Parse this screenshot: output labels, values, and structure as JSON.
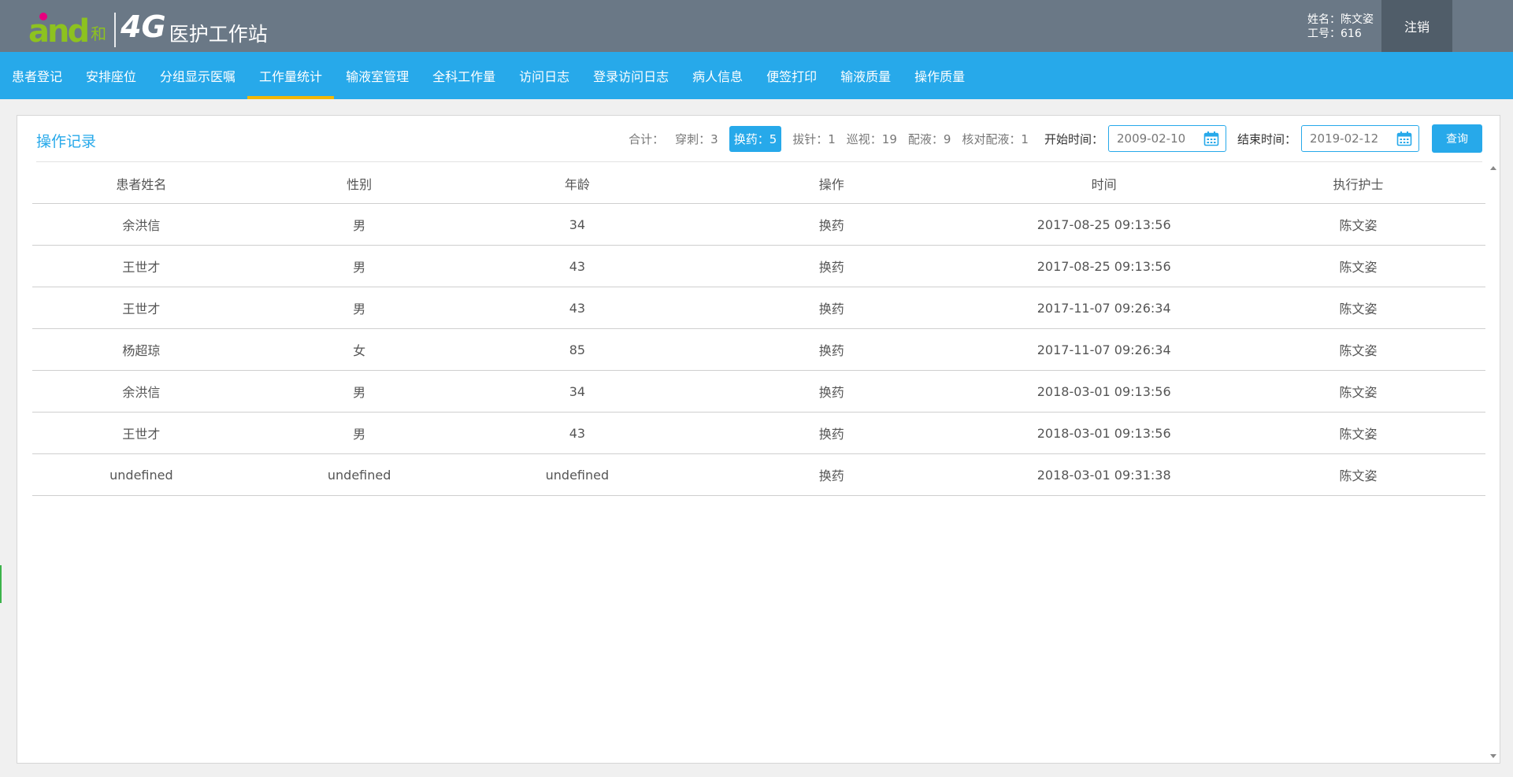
{
  "header": {
    "logo_and": "and",
    "logo_he": "和",
    "logo_4g": "4G",
    "app_title": "医护工作站",
    "user_name": "姓名：陈文姿",
    "user_id": "工号：616",
    "logout_label": "注销",
    "colors": {
      "bar": "#6a7886",
      "logo_green": "#8dc21f",
      "logo_pink": "#e6007e"
    }
  },
  "nav": {
    "items": [
      "患者登记",
      "安排座位",
      "分组显示医嘱",
      "工作量统计",
      "输液室管理",
      "全科工作量",
      "访问日志",
      "登录访问日志",
      "病人信息",
      "便签打印",
      "输液质量",
      "操作质量"
    ],
    "active_index": 3,
    "colors": {
      "bg": "#27a9ea",
      "active_underline": "#f2b705"
    }
  },
  "panel": {
    "title": "操作记录",
    "stats_label": "合计：",
    "stats": [
      "穿刺：3",
      "换药：5",
      "拔针：1",
      "巡视：19",
      "配液：9",
      "核对配液：1"
    ],
    "active_stat_index": 1,
    "start_label": "开始时间：",
    "start_value": "2009-02-10",
    "end_label": "结束时间：",
    "end_value": "2019-02-12",
    "calendar_icon": "calendar-icon",
    "query_label": "查询"
  },
  "table": {
    "columns": [
      "患者姓名",
      "性别",
      "年龄",
      "操作",
      "时间",
      "执行护士"
    ],
    "rows": [
      [
        "余洪信",
        "男",
        "34",
        "换药",
        "2017-08-25 09:13:56",
        "陈文姿"
      ],
      [
        "王世才",
        "男",
        "43",
        "换药",
        "2017-08-25 09:13:56",
        "陈文姿"
      ],
      [
        "王世才",
        "男",
        "43",
        "换药",
        "2017-11-07 09:26:34",
        "陈文姿"
      ],
      [
        "杨超琼",
        "女",
        "85",
        "换药",
        "2017-11-07 09:26:34",
        "陈文姿"
      ],
      [
        "余洪信",
        "男",
        "34",
        "换药",
        "2018-03-01 09:13:56",
        "陈文姿"
      ],
      [
        "王世才",
        "男",
        "43",
        "换药",
        "2018-03-01 09:13:56",
        "陈文姿"
      ],
      [
        "undefined",
        "undefined",
        "undefined",
        "换药",
        "2018-03-01 09:31:38",
        "陈文姿"
      ]
    ]
  }
}
